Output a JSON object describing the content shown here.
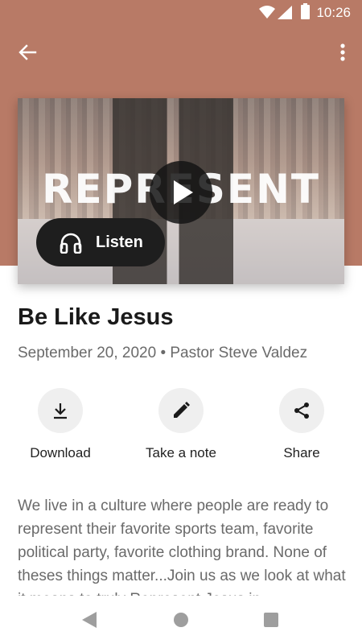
{
  "status_bar": {
    "time": "10:26"
  },
  "toolbar": {
    "back_icon": "arrow-back-icon",
    "menu_icon": "more-vert-icon"
  },
  "hero": {
    "artwork_text": "REPRESENT",
    "listen_label": "Listen",
    "play_icon": "play-icon",
    "listen_icon": "headphones-icon"
  },
  "sermon": {
    "title": "Be Like Jesus",
    "meta": "September 20, 2020 • Pastor Steve Valdez",
    "description": "We live in a culture where people are ready to represent their favorite sports team, favorite political party, favorite clothing brand. None of theses things matter...Join us as we look at what it means to truly Represent Jesus in"
  },
  "actions": [
    {
      "label": "Download",
      "icon": "download-icon"
    },
    {
      "label": "Take a note",
      "icon": "pencil-icon"
    },
    {
      "label": "Share",
      "icon": "share-icon"
    }
  ],
  "colors": {
    "header": "#b87a66",
    "button_dark": "#1e1e1e",
    "action_circle": "#efefef"
  }
}
